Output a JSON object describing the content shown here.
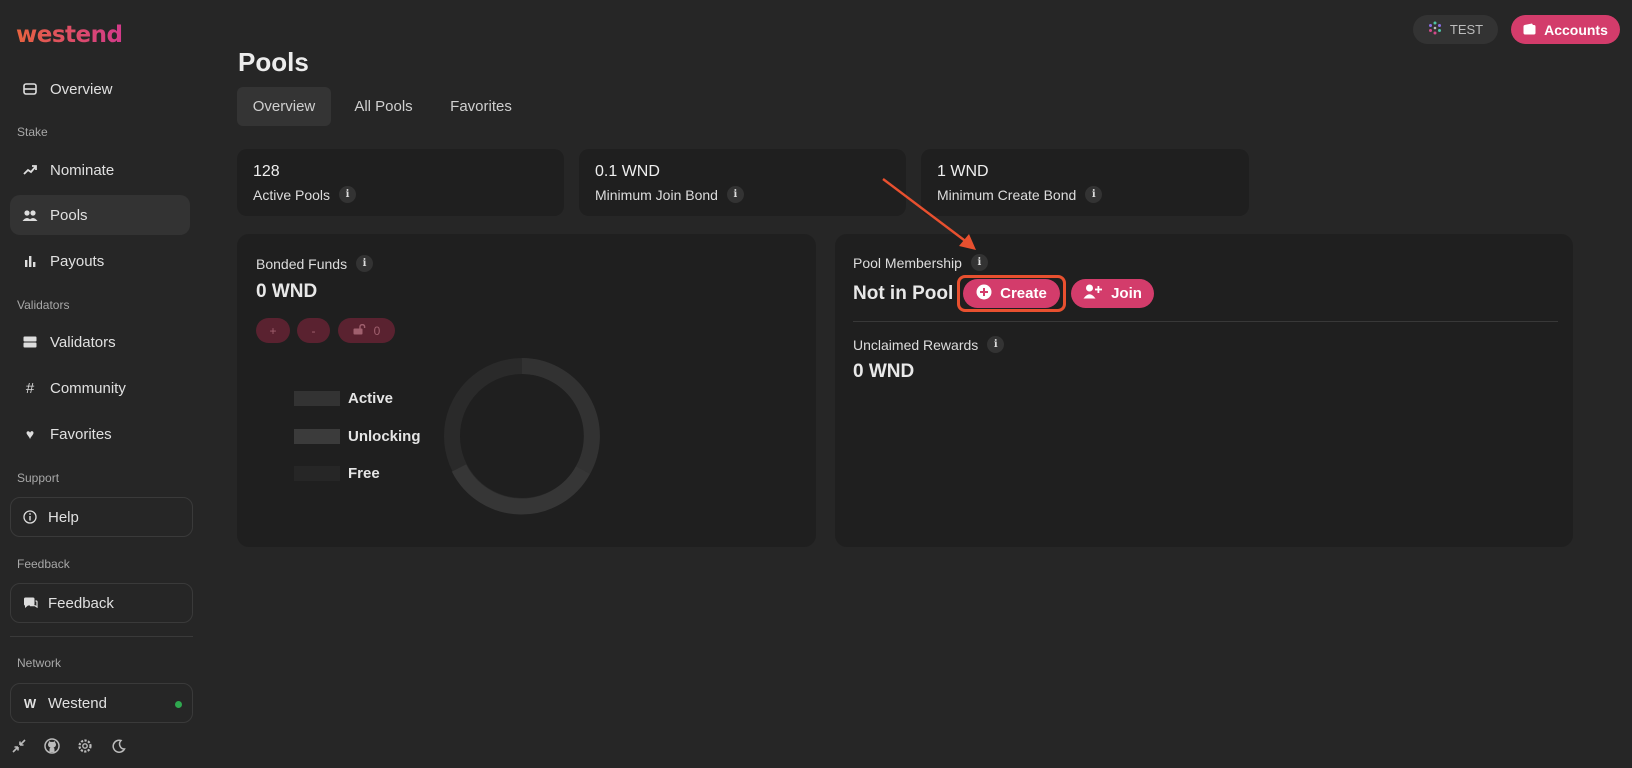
{
  "sidebar": {
    "logo": "westend",
    "items": [
      {
        "label": "Overview",
        "icon": "list-icon"
      },
      {
        "label": "Nominate",
        "icon": "trend-up-icon"
      },
      {
        "label": "Pools",
        "icon": "users-icon",
        "active": true
      },
      {
        "label": "Payouts",
        "icon": "bar-chart-icon"
      },
      {
        "label": "Validators",
        "icon": "server-icon"
      },
      {
        "label": "Community",
        "icon": "hash-icon"
      },
      {
        "label": "Favorites",
        "icon": "heart-icon"
      }
    ],
    "sections": {
      "stake": "Stake",
      "validators": "Validators",
      "support": "Support",
      "feedback": "Feedback",
      "network": "Network"
    },
    "help_label": "Help",
    "feedback_label": "Feedback",
    "network_name": "Westend",
    "network_status_color": "#2fa84f"
  },
  "header": {
    "test_label": "TEST",
    "accounts_label": "Accounts",
    "accent_color": "#d33c6b"
  },
  "page": {
    "title": "Pools",
    "tabs": [
      {
        "label": "Overview",
        "active": true
      },
      {
        "label": "All Pools"
      },
      {
        "label": "Favorites"
      }
    ]
  },
  "stats": [
    {
      "value": "128",
      "label": "Active Pools"
    },
    {
      "value": "0.1 WND",
      "label": "Minimum Join Bond"
    },
    {
      "value": "1 WND",
      "label": "Minimum Create Bond"
    }
  ],
  "bonded": {
    "label": "Bonded Funds",
    "value": "0 WND",
    "add_label": "+",
    "remove_label": "-",
    "unlock_count": "0",
    "legend": [
      "Active",
      "Unlocking",
      "Free"
    ]
  },
  "membership": {
    "label": "Pool Membership",
    "status": "Not in Pool",
    "create_label": "Create",
    "join_label": "Join",
    "rewards_label": "Unclaimed Rewards",
    "rewards_value": "0 WND"
  }
}
